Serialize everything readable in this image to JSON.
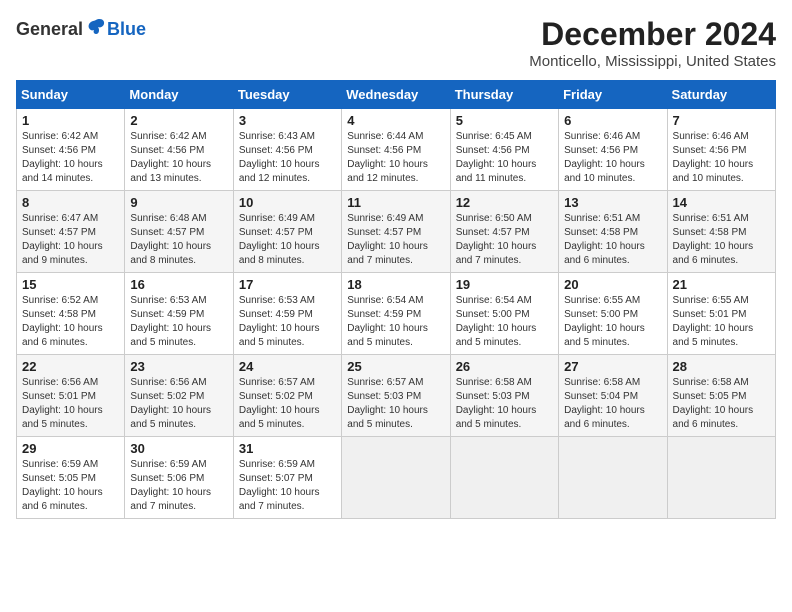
{
  "header": {
    "logo_general": "General",
    "logo_blue": "Blue",
    "month_title": "December 2024",
    "location": "Monticello, Mississippi, United States"
  },
  "days_of_week": [
    "Sunday",
    "Monday",
    "Tuesday",
    "Wednesday",
    "Thursday",
    "Friday",
    "Saturday"
  ],
  "weeks": [
    [
      {
        "day": "1",
        "sunrise": "6:42 AM",
        "sunset": "4:56 PM",
        "daylight": "10 hours and 14 minutes."
      },
      {
        "day": "2",
        "sunrise": "6:42 AM",
        "sunset": "4:56 PM",
        "daylight": "10 hours and 13 minutes."
      },
      {
        "day": "3",
        "sunrise": "6:43 AM",
        "sunset": "4:56 PM",
        "daylight": "10 hours and 12 minutes."
      },
      {
        "day": "4",
        "sunrise": "6:44 AM",
        "sunset": "4:56 PM",
        "daylight": "10 hours and 12 minutes."
      },
      {
        "day": "5",
        "sunrise": "6:45 AM",
        "sunset": "4:56 PM",
        "daylight": "10 hours and 11 minutes."
      },
      {
        "day": "6",
        "sunrise": "6:46 AM",
        "sunset": "4:56 PM",
        "daylight": "10 hours and 10 minutes."
      },
      {
        "day": "7",
        "sunrise": "6:46 AM",
        "sunset": "4:56 PM",
        "daylight": "10 hours and 10 minutes."
      }
    ],
    [
      {
        "day": "8",
        "sunrise": "6:47 AM",
        "sunset": "4:57 PM",
        "daylight": "10 hours and 9 minutes."
      },
      {
        "day": "9",
        "sunrise": "6:48 AM",
        "sunset": "4:57 PM",
        "daylight": "10 hours and 8 minutes."
      },
      {
        "day": "10",
        "sunrise": "6:49 AM",
        "sunset": "4:57 PM",
        "daylight": "10 hours and 8 minutes."
      },
      {
        "day": "11",
        "sunrise": "6:49 AM",
        "sunset": "4:57 PM",
        "daylight": "10 hours and 7 minutes."
      },
      {
        "day": "12",
        "sunrise": "6:50 AM",
        "sunset": "4:57 PM",
        "daylight": "10 hours and 7 minutes."
      },
      {
        "day": "13",
        "sunrise": "6:51 AM",
        "sunset": "4:58 PM",
        "daylight": "10 hours and 6 minutes."
      },
      {
        "day": "14",
        "sunrise": "6:51 AM",
        "sunset": "4:58 PM",
        "daylight": "10 hours and 6 minutes."
      }
    ],
    [
      {
        "day": "15",
        "sunrise": "6:52 AM",
        "sunset": "4:58 PM",
        "daylight": "10 hours and 6 minutes."
      },
      {
        "day": "16",
        "sunrise": "6:53 AM",
        "sunset": "4:59 PM",
        "daylight": "10 hours and 5 minutes."
      },
      {
        "day": "17",
        "sunrise": "6:53 AM",
        "sunset": "4:59 PM",
        "daylight": "10 hours and 5 minutes."
      },
      {
        "day": "18",
        "sunrise": "6:54 AM",
        "sunset": "4:59 PM",
        "daylight": "10 hours and 5 minutes."
      },
      {
        "day": "19",
        "sunrise": "6:54 AM",
        "sunset": "5:00 PM",
        "daylight": "10 hours and 5 minutes."
      },
      {
        "day": "20",
        "sunrise": "6:55 AM",
        "sunset": "5:00 PM",
        "daylight": "10 hours and 5 minutes."
      },
      {
        "day": "21",
        "sunrise": "6:55 AM",
        "sunset": "5:01 PM",
        "daylight": "10 hours and 5 minutes."
      }
    ],
    [
      {
        "day": "22",
        "sunrise": "6:56 AM",
        "sunset": "5:01 PM",
        "daylight": "10 hours and 5 minutes."
      },
      {
        "day": "23",
        "sunrise": "6:56 AM",
        "sunset": "5:02 PM",
        "daylight": "10 hours and 5 minutes."
      },
      {
        "day": "24",
        "sunrise": "6:57 AM",
        "sunset": "5:02 PM",
        "daylight": "10 hours and 5 minutes."
      },
      {
        "day": "25",
        "sunrise": "6:57 AM",
        "sunset": "5:03 PM",
        "daylight": "10 hours and 5 minutes."
      },
      {
        "day": "26",
        "sunrise": "6:58 AM",
        "sunset": "5:03 PM",
        "daylight": "10 hours and 5 minutes."
      },
      {
        "day": "27",
        "sunrise": "6:58 AM",
        "sunset": "5:04 PM",
        "daylight": "10 hours and 6 minutes."
      },
      {
        "day": "28",
        "sunrise": "6:58 AM",
        "sunset": "5:05 PM",
        "daylight": "10 hours and 6 minutes."
      }
    ],
    [
      {
        "day": "29",
        "sunrise": "6:59 AM",
        "sunset": "5:05 PM",
        "daylight": "10 hours and 6 minutes."
      },
      {
        "day": "30",
        "sunrise": "6:59 AM",
        "sunset": "5:06 PM",
        "daylight": "10 hours and 7 minutes."
      },
      {
        "day": "31",
        "sunrise": "6:59 AM",
        "sunset": "5:07 PM",
        "daylight": "10 hours and 7 minutes."
      },
      null,
      null,
      null,
      null
    ]
  ]
}
